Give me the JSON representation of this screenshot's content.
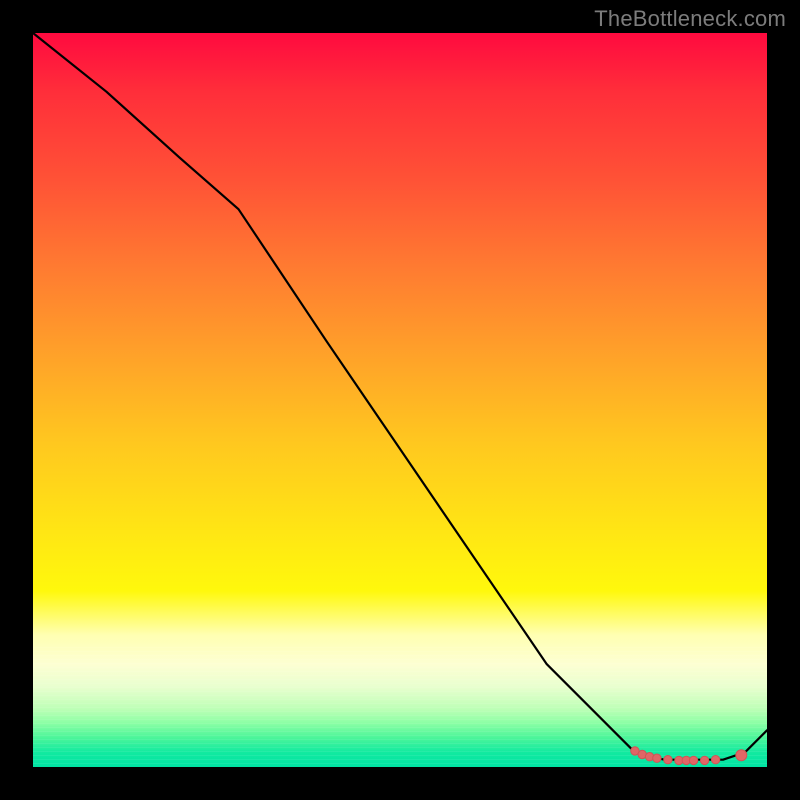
{
  "attribution": "TheBottleneck.com",
  "colors": {
    "curve_stroke": "#000000",
    "marker_fill": "#e06666",
    "marker_stroke": "#d05555",
    "frame": "#000000",
    "gradient_top": "#ff0a3f",
    "gradient_mid": "#ffe614",
    "gradient_bottom": "#00e3a3"
  },
  "chart_data": {
    "type": "line",
    "title": "",
    "xlabel": "",
    "ylabel": "",
    "xlim": [
      0,
      100
    ],
    "ylim": [
      0,
      100
    ],
    "series": [
      {
        "name": "curve",
        "x": [
          0,
          10,
          20,
          28,
          40,
          55,
          70,
          82,
          86,
          90,
          94,
          97,
          100
        ],
        "y": [
          100,
          92,
          83,
          76,
          58,
          36,
          14,
          2,
          1,
          1,
          1,
          2,
          5
        ]
      }
    ],
    "markers": [
      {
        "name": "cluster-a",
        "points": [
          {
            "x": 82.0,
            "y": 2.2
          },
          {
            "x": 83.0,
            "y": 1.7
          },
          {
            "x": 84.0,
            "y": 1.4
          },
          {
            "x": 85.0,
            "y": 1.2
          },
          {
            "x": 86.5,
            "y": 1.0
          },
          {
            "x": 88.0,
            "y": 0.9
          },
          {
            "x": 89.0,
            "y": 0.9
          },
          {
            "x": 90.0,
            "y": 0.9
          },
          {
            "x": 91.5,
            "y": 0.9
          },
          {
            "x": 93.0,
            "y": 1.0
          }
        ]
      },
      {
        "name": "point-b",
        "points": [
          {
            "x": 96.5,
            "y": 1.6
          }
        ]
      }
    ]
  }
}
